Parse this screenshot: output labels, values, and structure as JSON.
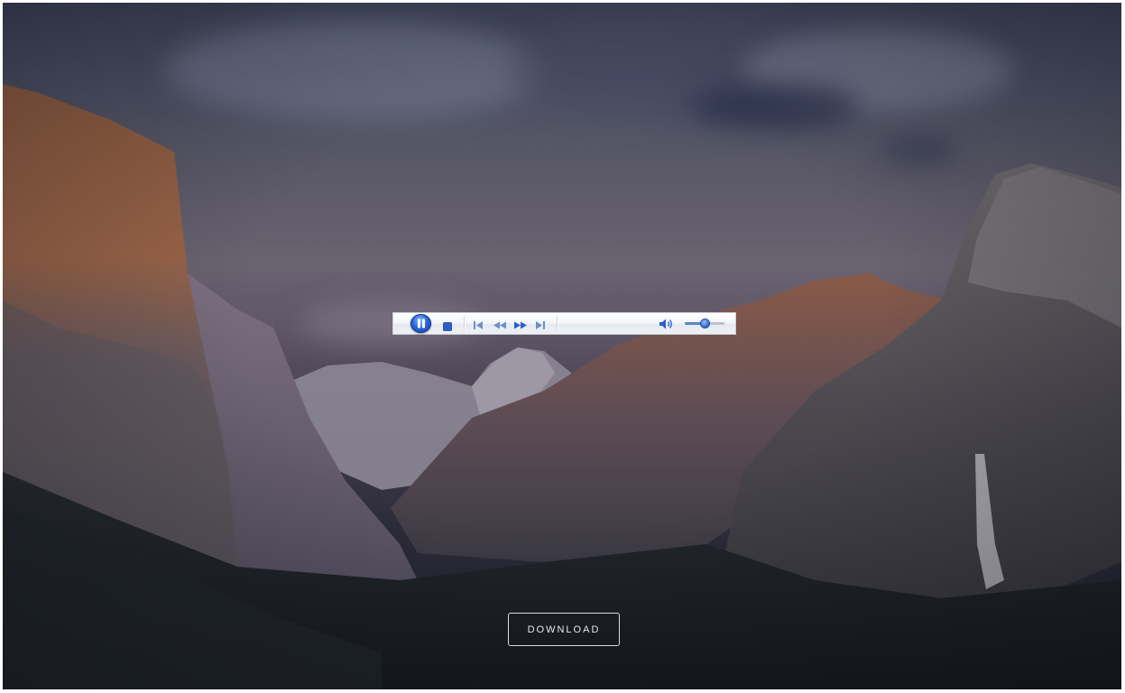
{
  "background": {
    "scene": "mountain-valley-photo",
    "accent": "#2a64d8"
  },
  "player": {
    "state": "playing",
    "volume": 0.5,
    "icons": {
      "pause": "pause-icon",
      "stop": "stop-icon",
      "previous": "skip-back-icon",
      "rewind": "rewind-icon",
      "fast_forward": "fast-forward-icon",
      "next": "skip-forward-icon",
      "volume": "speaker-icon"
    }
  },
  "cta": {
    "download_label": "DOWNLOAD"
  }
}
